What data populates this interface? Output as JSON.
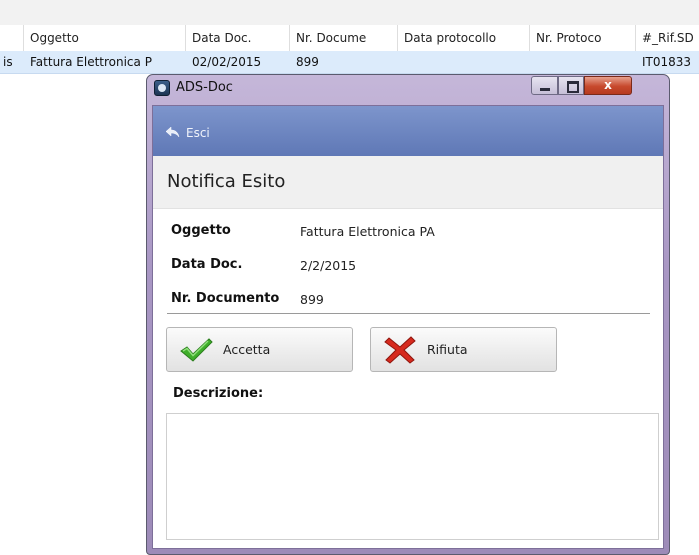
{
  "grid": {
    "columns": [
      "Oggetto",
      "Data Doc.",
      "Nr. Documе",
      "Data protocollo",
      "Nr. Protoco",
      "#_Rif.SD"
    ],
    "row": {
      "col0": "is",
      "oggetto": "Fattura Elettronica P",
      "data_doc": "02/02/2015",
      "nr_documento": "899",
      "rif": "IT01833"
    }
  },
  "window": {
    "title": "ADS-Doc",
    "close_symbol": "x",
    "icon": "ads-doc-app-icon"
  },
  "toolbar": {
    "exit_label": "Esci",
    "exit_icon": "exit-arrow-icon"
  },
  "form": {
    "section_title": "Notifica Esito",
    "fields": [
      {
        "label": "Oggetto",
        "value": "Fattura Elettronica PA"
      },
      {
        "label": "Data Doc.",
        "value": "2/2/2015"
      },
      {
        "label": "Nr. Documento",
        "value": "899"
      }
    ],
    "accept_label": "Accetta",
    "accept_icon": "green-check-icon",
    "reject_label": "Rifiuta",
    "reject_icon": "red-x-icon",
    "description_label": "Descrizione:",
    "description_value": ""
  }
}
